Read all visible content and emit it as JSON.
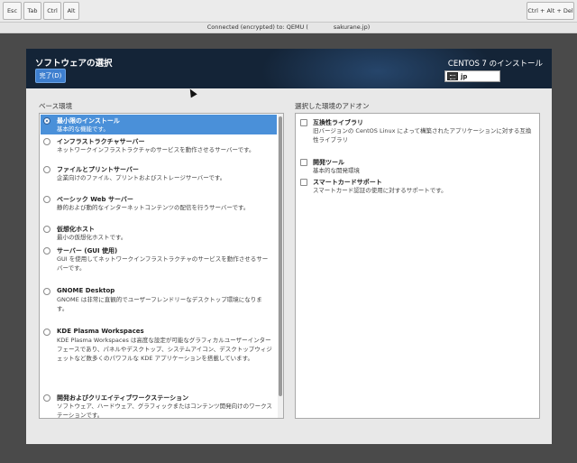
{
  "vnc": {
    "keys": [
      "Esc",
      "Tab",
      "Ctrl",
      "Alt"
    ],
    "ctrl_alt_del": "Ctrl + Alt + Del",
    "status_text": "Connected (encrypted) to: QEMU (",
    "status_host": "sakurane.jp)"
  },
  "header": {
    "title": "ソフトウェアの選択",
    "done_label": "完了(D)",
    "product_title": "CENTOS 7 のインストール",
    "keyboard_layout": "jp"
  },
  "environments": {
    "label": "ベース環境",
    "selected_index": 0,
    "items": [
      {
        "name": "最小限のインストール",
        "desc": "基本的な機能です。"
      },
      {
        "name": "インフラストラクチャサーバー",
        "desc": "ネットワークインフラストラクチャのサービスを動作させるサーバーです。"
      },
      {
        "name": "ファイルとプリントサーバー",
        "desc": "企業向けのファイル、プリントおよびストレージサーバーです。"
      },
      {
        "name": "ベーシック Web サーバー",
        "desc": "静的および動的なインターネットコンテンツの配信を行うサーバーです。"
      },
      {
        "name": "仮想化ホスト",
        "desc": "最小の仮想化ホストです。"
      },
      {
        "name": "サーバー (GUI 使用)",
        "desc": "GUI を使用してネットワークインフラストラクチャのサービスを動作させるサーバーです。"
      },
      {
        "name": "GNOME Desktop",
        "desc": "GNOME は非常に直観的でユーザーフレンドリーなデスクトップ環境になります。"
      },
      {
        "name": "KDE Plasma Workspaces",
        "desc": "KDE Plasma Workspaces は高度な設定が可能なグラフィカルユーザーインターフェースであり、パネルやデスクトップ、システムアイコン、デスクトップウィジェットなど数多くのパワフルな KDE アプリケーションを搭載しています。"
      },
      {
        "name": "開発およびクリエイティブワークステーション",
        "desc": "ソフトウェア、ハードウェア、グラフィックまたはコンテンツ開発向けのワークステーションです。"
      }
    ]
  },
  "addons": {
    "label": "選択した環境のアドオン",
    "items": [
      {
        "name": "互換性ライブラリ",
        "desc": "旧バージョンの CentOS Linux によって構築されたアプリケーションに対する互換性ライブラリ",
        "checked": false
      },
      {
        "name": "開発ツール",
        "desc": "基本的な開発環境",
        "checked": false
      },
      {
        "name": "スマートカードサポート",
        "desc": "スマートカード認証の使用に対するサポートです。",
        "checked": false
      }
    ]
  }
}
